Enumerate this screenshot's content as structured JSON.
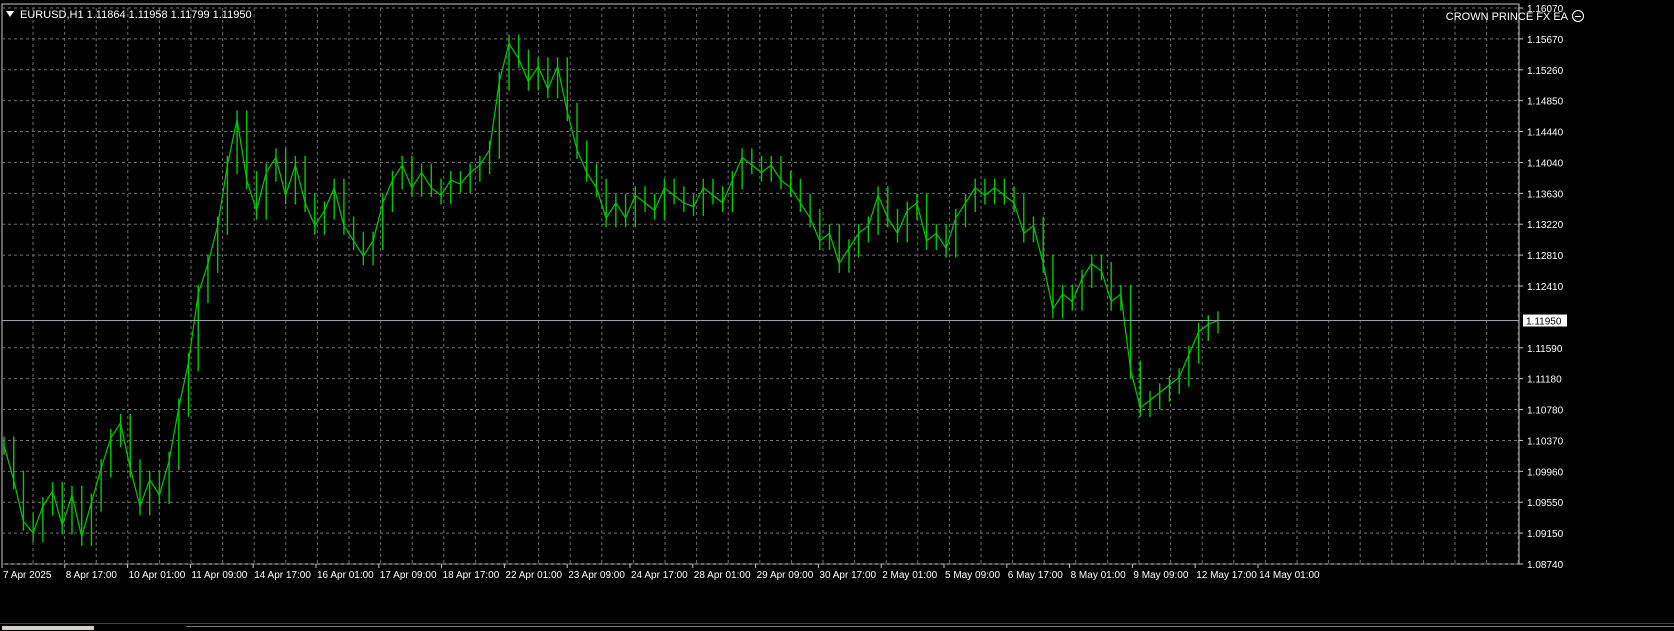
{
  "window": {
    "symbol_line": "EURUSD,H1  1.11864 1.11958 1.11799 1.11950",
    "expert_label": "CROWN PRINCE FX EA"
  },
  "colors": {
    "background": "#000000",
    "grid": "#6f6f6f",
    "bars": "#00c800",
    "axis_text": "#ffffff",
    "current_price_line": "#9aa3ad",
    "price_tag_bg": "#ffffff",
    "price_tag_text": "#000000"
  },
  "icons": [
    "collapse-triangle-icon",
    "smiley-icon"
  ],
  "chart_data": {
    "type": "line",
    "symbol": "EURUSD",
    "timeframe": "H1",
    "ohlc_current": {
      "open": 1.11864,
      "high": 1.11958,
      "low": 1.11799,
      "close": 1.1195
    },
    "current_price_label": "1.11950",
    "grid": true,
    "ylim": [
      1.0874,
      1.1607
    ],
    "y_ticks": [
      "1.16070",
      "1.15670",
      "1.15260",
      "1.14850",
      "1.14440",
      "1.14040",
      "1.13630",
      "1.13220",
      "1.12810",
      "1.12410",
      "1.11950",
      "1.11590",
      "1.11180",
      "1.10780",
      "1.10370",
      "1.09960",
      "1.09550",
      "1.09150",
      "1.08740"
    ],
    "x_ticks": [
      "7 Apr 2025",
      "8 Apr 17:00",
      "10 Apr 01:00",
      "11 Apr 09:00",
      "14 Apr 17:00",
      "16 Apr 01:00",
      "17 Apr 09:00",
      "18 Apr 17:00",
      "22 Apr 01:00",
      "23 Apr 09:00",
      "24 Apr 17:00",
      "28 Apr 01:00",
      "29 Apr 09:00",
      "30 Apr 17:00",
      "2 May 01:00",
      "5 May 09:00",
      "6 May 17:00",
      "8 May 01:00",
      "9 May 09:00",
      "12 May 17:00",
      "14 May 01:00"
    ],
    "series": [
      {
        "values": [
          1.103,
          1.0985,
          1.093,
          1.0915,
          1.095,
          1.097,
          1.0925,
          1.0965,
          1.091,
          1.0955,
          1.1,
          1.104,
          1.106,
          1.1,
          1.095,
          1.0985,
          1.0965,
          1.101,
          1.108,
          1.114,
          1.123,
          1.127,
          1.132,
          1.14,
          1.146,
          1.138,
          1.134,
          1.139,
          1.141,
          1.136,
          1.14,
          1.135,
          1.132,
          1.134,
          1.137,
          1.132,
          1.13,
          1.128,
          1.13,
          1.135,
          1.138,
          1.14,
          1.137,
          1.139,
          1.137,
          1.136,
          1.138,
          1.1375,
          1.139,
          1.14,
          1.142,
          1.151,
          1.156,
          1.154,
          1.151,
          1.153,
          1.15,
          1.153,
          1.147,
          1.142,
          1.139,
          1.137,
          1.133,
          1.135,
          1.133,
          1.136,
          1.135,
          1.134,
          1.137,
          1.136,
          1.135,
          1.1345,
          1.137,
          1.136,
          1.135,
          1.138,
          1.141,
          1.14,
          1.139,
          1.14,
          1.138,
          1.137,
          1.135,
          1.133,
          1.13,
          1.131,
          1.127,
          1.129,
          1.131,
          1.132,
          1.136,
          1.133,
          1.131,
          1.134,
          1.135,
          1.13,
          1.131,
          1.129,
          1.133,
          1.135,
          1.137,
          1.136,
          1.137,
          1.136,
          1.135,
          1.131,
          1.132,
          1.127,
          1.121,
          1.123,
          1.122,
          1.125,
          1.127,
          1.126,
          1.122,
          1.123,
          1.113,
          1.108,
          1.109,
          1.11,
          1.111,
          1.112,
          1.115,
          1.118,
          1.119,
          1.1195
        ]
      }
    ]
  }
}
